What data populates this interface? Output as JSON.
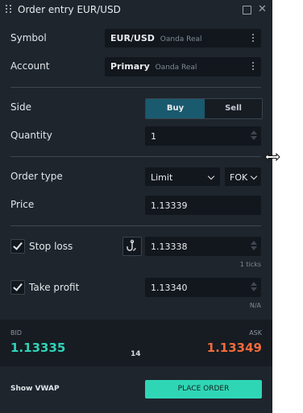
{
  "window": {
    "title": "Order entry EUR/USD"
  },
  "symbol": {
    "label": "Symbol",
    "value": "EUR/USD",
    "source": "Oanda Real"
  },
  "account": {
    "label": "Account",
    "value": "Primary",
    "source": "Oanda Real"
  },
  "side": {
    "label": "Side",
    "buy": "Buy",
    "sell": "Sell",
    "selected": "Buy"
  },
  "quantity": {
    "label": "Quantity",
    "value": "1"
  },
  "order_type": {
    "label": "Order type",
    "type": "Limit",
    "tif": "FOK"
  },
  "price": {
    "label": "Price",
    "value": "1.13339"
  },
  "stop_loss": {
    "label": "Stop loss",
    "checked": true,
    "value": "1.13338",
    "hint": "1 ticks"
  },
  "take_profit": {
    "label": "Take profit",
    "checked": true,
    "value": "1.13340",
    "hint": "N/A"
  },
  "quote": {
    "bid_label": "BID",
    "bid": "1.13335",
    "ask_label": "ASK",
    "ask": "1.13349",
    "spread": "14"
  },
  "footer": {
    "vwap_label": "Show VWAP",
    "place_order": "PLACE ORDER"
  },
  "colors": {
    "panel": "#1e252d",
    "bid": "#30d2b8",
    "ask": "#f06b3c",
    "accent": "#2fd6b6",
    "buy_selected": "#1a5a6e"
  }
}
